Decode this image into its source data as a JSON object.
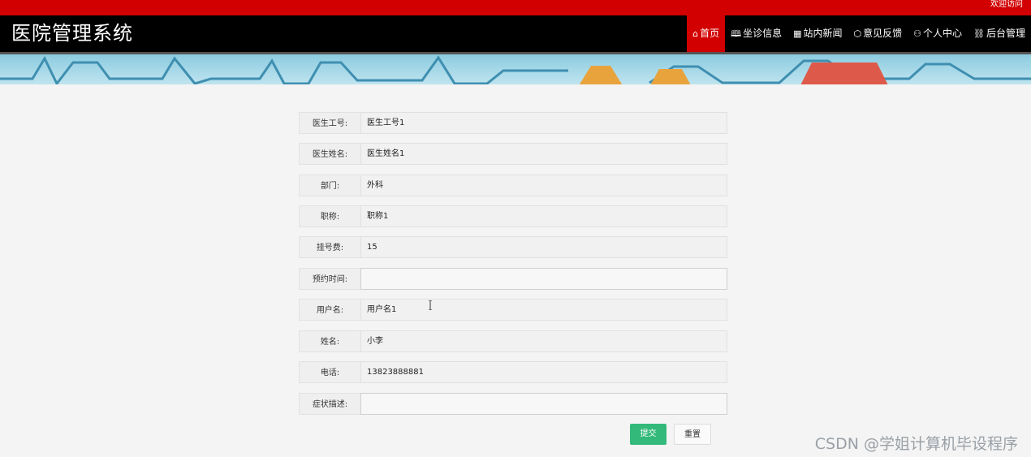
{
  "topbar": {
    "welcome": "欢迎访问"
  },
  "header": {
    "title": "医院管理系统"
  },
  "nav": [
    {
      "icon": "home-icon",
      "glyph": "⌂",
      "label": "首页"
    },
    {
      "icon": "book-icon",
      "glyph": "🕮",
      "label": "坐诊信息"
    },
    {
      "icon": "grid-icon",
      "glyph": "▦",
      "label": "站内新闻"
    },
    {
      "icon": "cube-icon",
      "glyph": "⬡",
      "label": "意见反馈"
    },
    {
      "icon": "user-icon",
      "glyph": "⚇",
      "label": "个人中心"
    },
    {
      "icon": "link-icon",
      "glyph": "⛓",
      "label": "后台管理"
    }
  ],
  "form": {
    "fields": [
      {
        "label": "医生工号:",
        "value": "医生工号1"
      },
      {
        "label": "医生姓名:",
        "value": "医生姓名1"
      },
      {
        "label": "部门:",
        "value": "外科"
      },
      {
        "label": "职称:",
        "value": "职称1"
      },
      {
        "label": "挂号费:",
        "value": "15"
      },
      {
        "label": "预约时间:",
        "value": ""
      },
      {
        "label": "用户名:",
        "value": "用户名1"
      },
      {
        "label": "姓名:",
        "value": "小李"
      },
      {
        "label": "电话:",
        "value": "13823888881"
      },
      {
        "label": "症状描述:",
        "value": ""
      }
    ],
    "submit_label": "提交",
    "reset_label": "重置"
  },
  "watermark": "CSDN @学姐计算机毕设程序",
  "colors": {
    "topbar": "#d20000",
    "navbar": "#000000",
    "active_nav": "#d20000",
    "submit": "#33b97a"
  }
}
